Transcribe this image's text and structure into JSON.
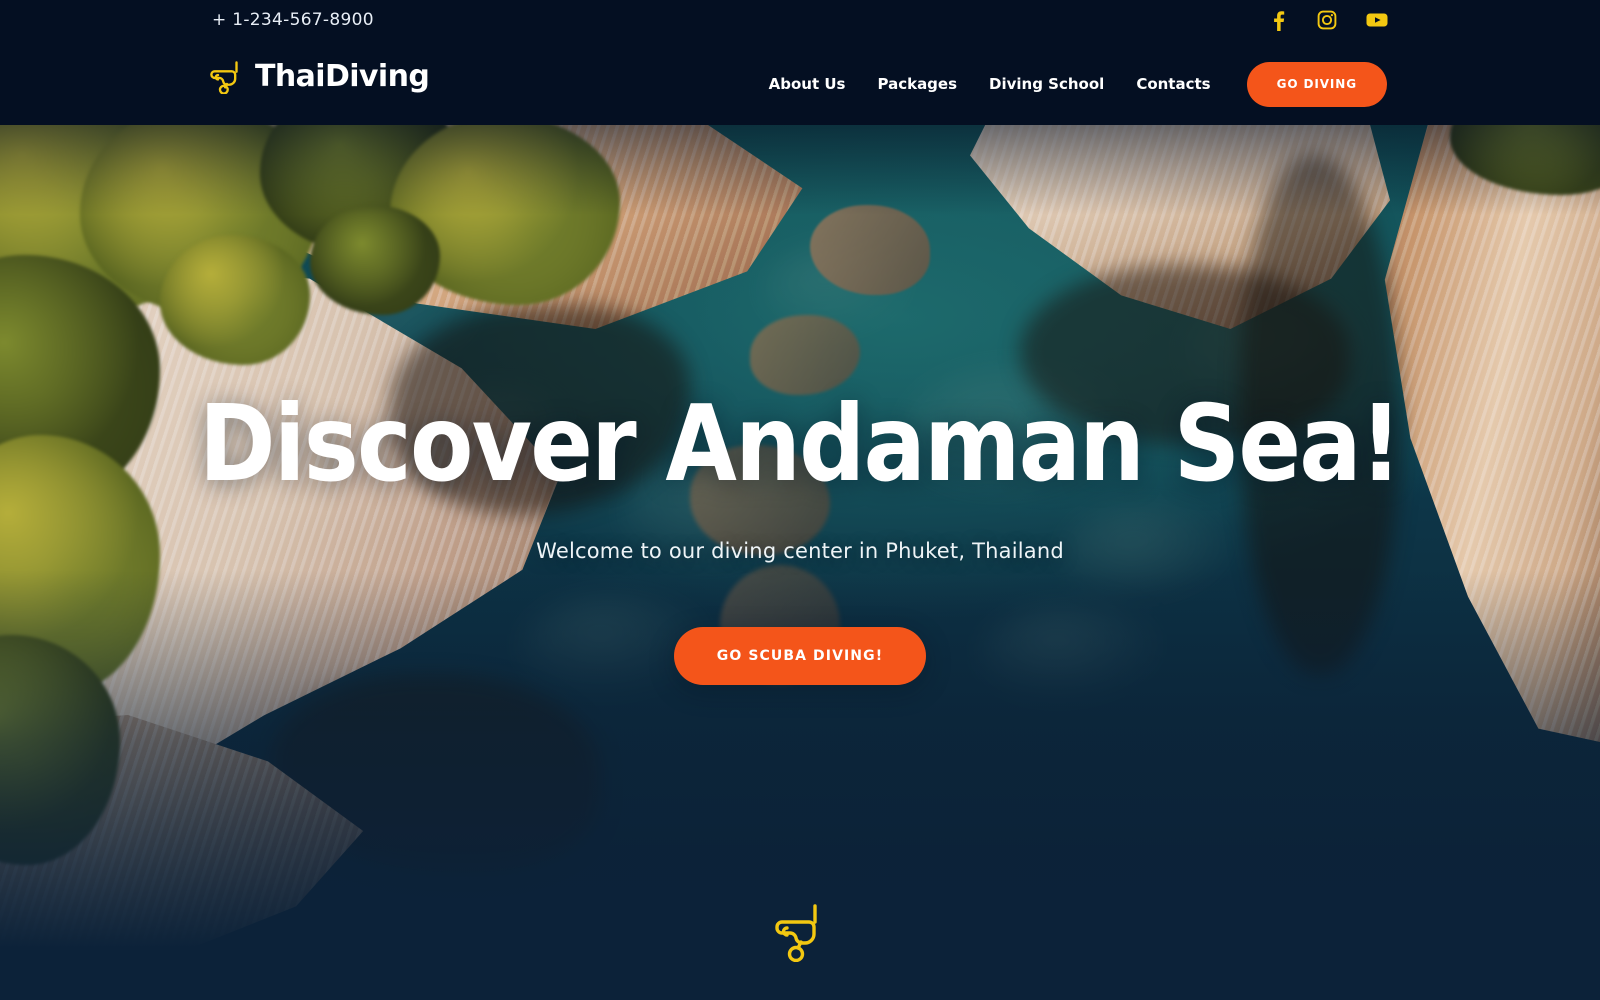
{
  "site": {
    "brand": "ThaiDiving",
    "logo_icon": "scuba-mask-icon"
  },
  "topbar": {
    "phone": "+ 1-234-567-8900",
    "socials": [
      {
        "name": "facebook-icon",
        "label": "Facebook"
      },
      {
        "name": "instagram-icon",
        "label": "Instagram"
      },
      {
        "name": "youtube-icon",
        "label": "YouTube"
      }
    ]
  },
  "nav": {
    "items": [
      {
        "label": "About Us"
      },
      {
        "label": "Packages"
      },
      {
        "label": "Diving School"
      },
      {
        "label": "Contacts"
      }
    ],
    "cta_label": "GO DIVING"
  },
  "hero": {
    "title": "Discover Andaman Sea!",
    "subtitle": "Welcome to our diving center in Phuket, Thailand",
    "cta_label": "GO SCUBA DIVING!",
    "scroll_icon": "scuba-mask-icon",
    "background": "aerial photo of limestone cliffs and turquoise sea"
  },
  "colors": {
    "header_bg": "#040f22",
    "accent_orange": "#f4551a",
    "accent_yellow": "#f3c811",
    "text_light": "#ffffff",
    "water_deep": "#0c2239",
    "water_teal": "#11505 5"
  }
}
